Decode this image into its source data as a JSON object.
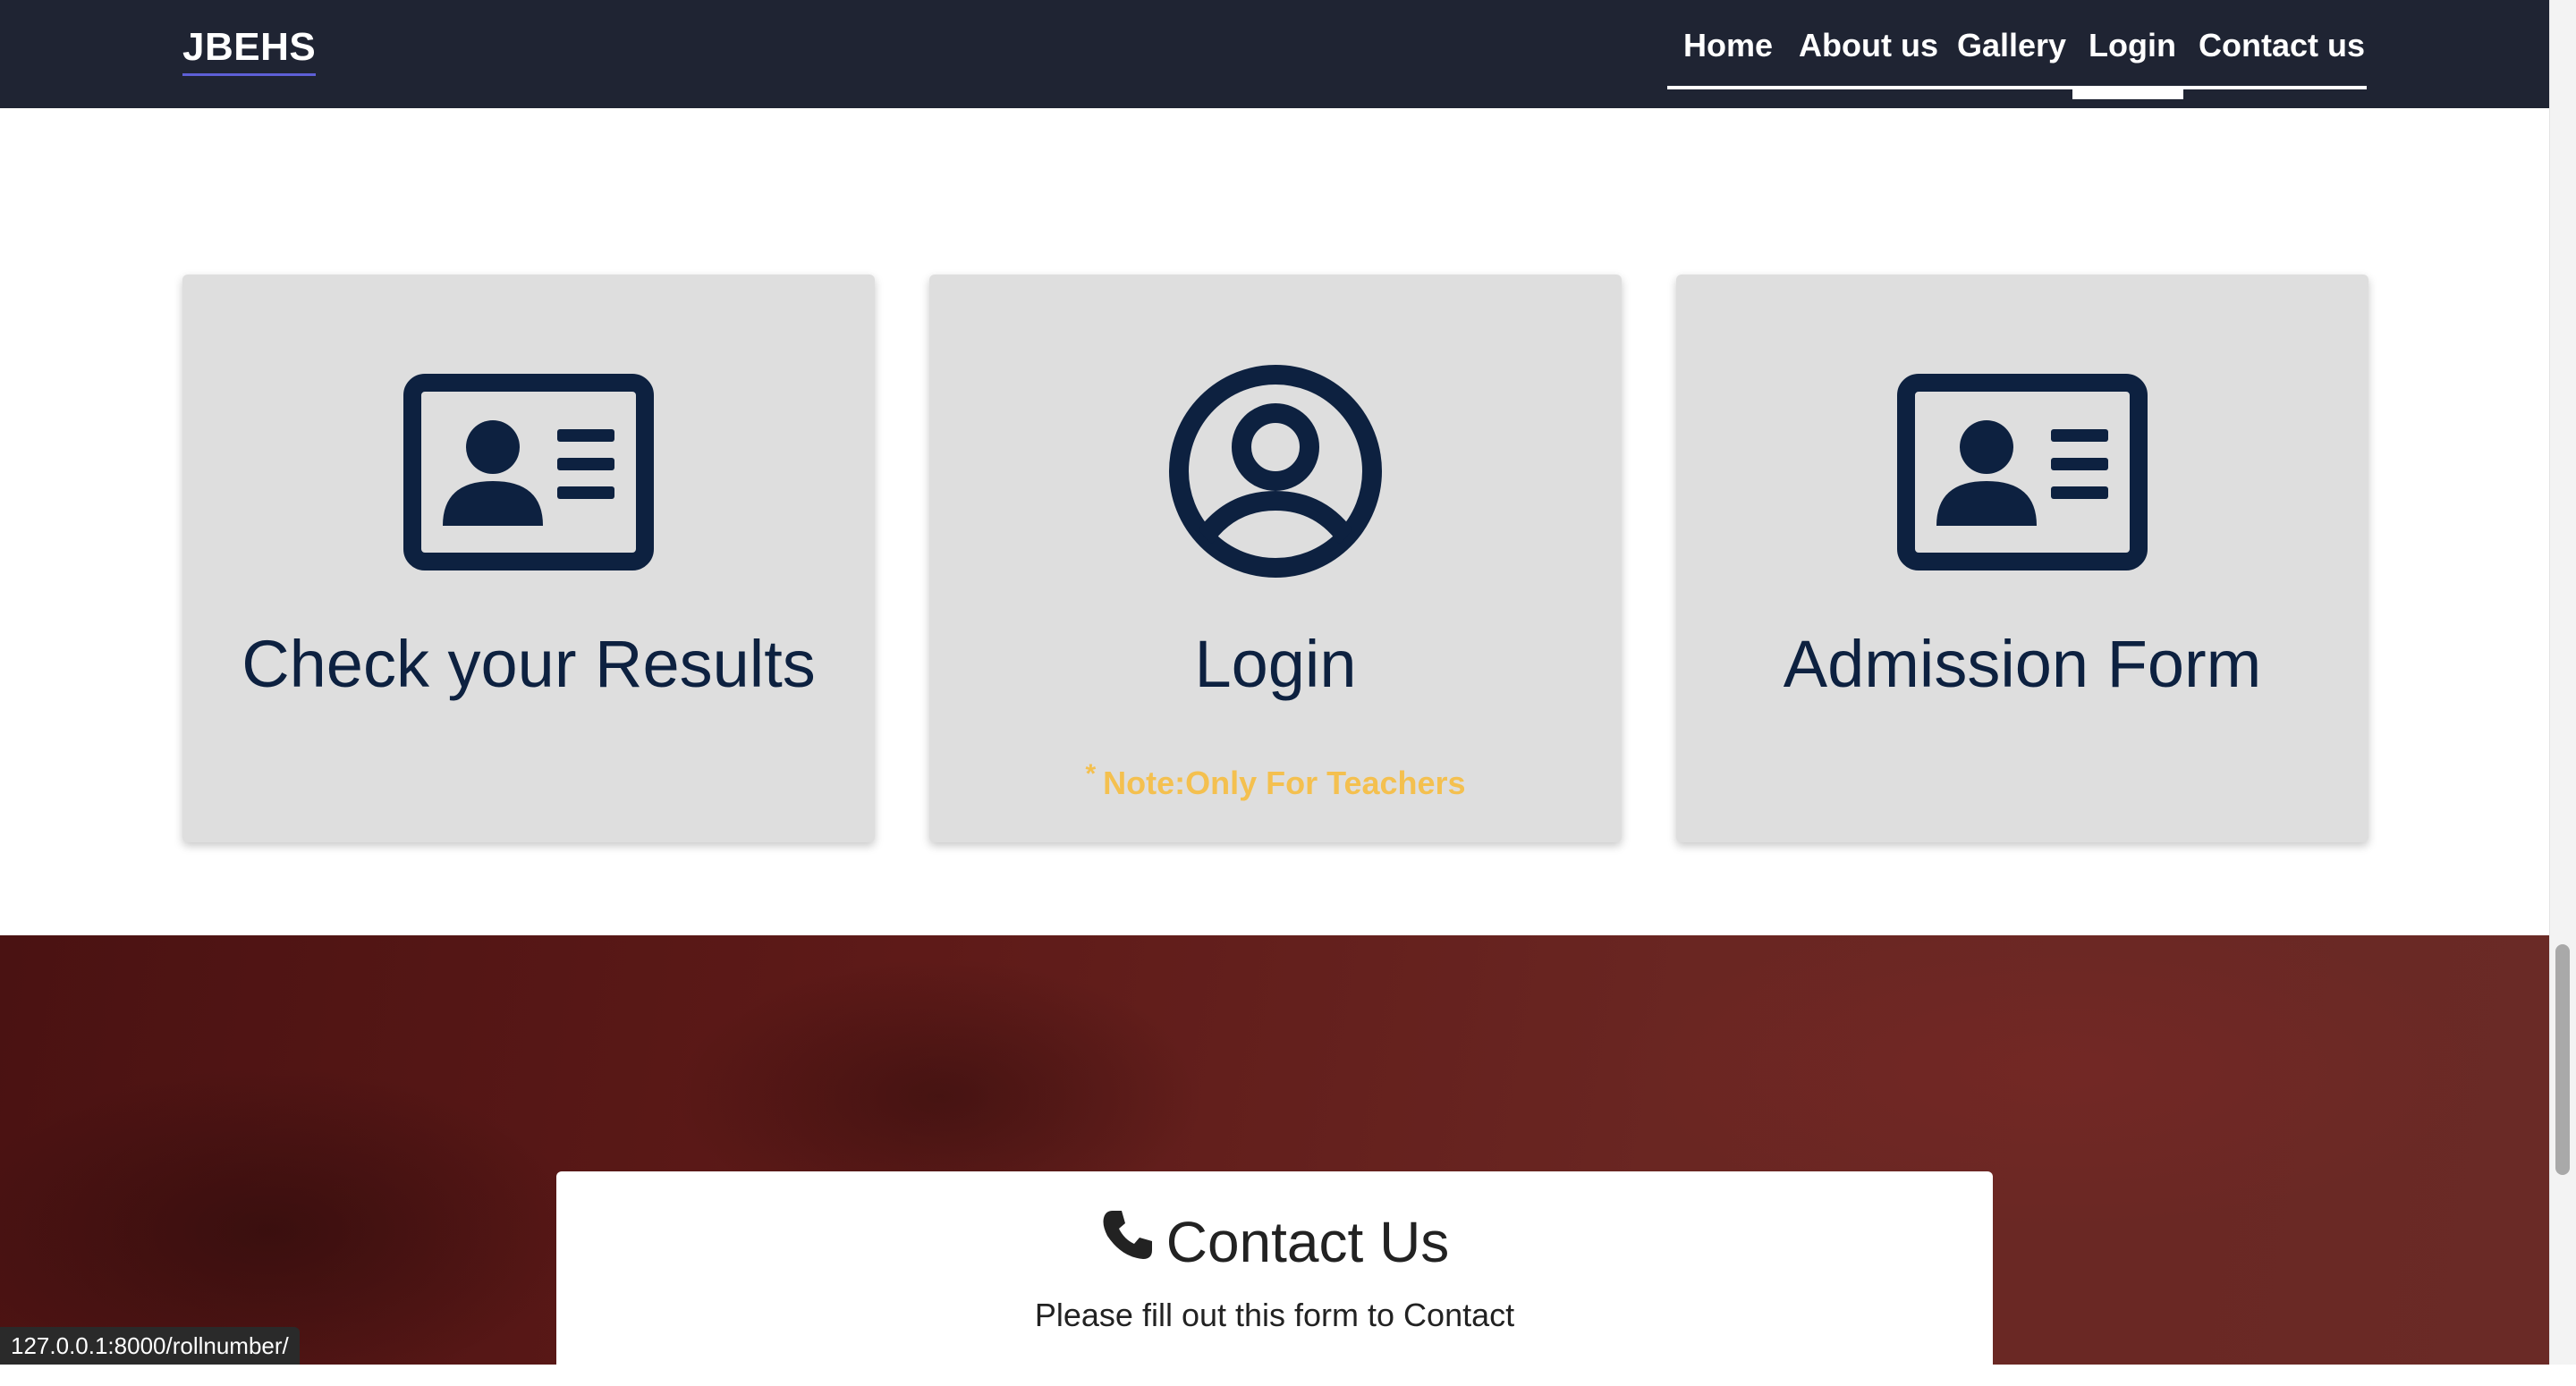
{
  "navbar": {
    "brand": "JBEHS",
    "links": [
      {
        "label": "Home"
      },
      {
        "label": "About us"
      },
      {
        "label": "Gallery"
      },
      {
        "label": "Login"
      },
      {
        "label": "Contact us"
      }
    ],
    "active": "Login"
  },
  "cards": [
    {
      "title": "Check your Results",
      "icon": "id-card-icon"
    },
    {
      "title": "Login",
      "icon": "user-circle-icon",
      "note_star": "*",
      "note": "Note:Only For Teachers"
    },
    {
      "title": "Admission Form",
      "icon": "id-card-icon"
    }
  ],
  "contact": {
    "heading": "Contact Us",
    "subtitle": "Please fill out this form to Contact",
    "icon": "phone-icon"
  },
  "status_bar": {
    "url": "127.0.0.1:8000/rollnumber/"
  },
  "colors": {
    "navbar_bg": "#1f2433",
    "card_bg": "#dedede",
    "icon_color": "#0d2140",
    "note_color": "#f4c04f",
    "hero_bg": "#5e1a18"
  }
}
